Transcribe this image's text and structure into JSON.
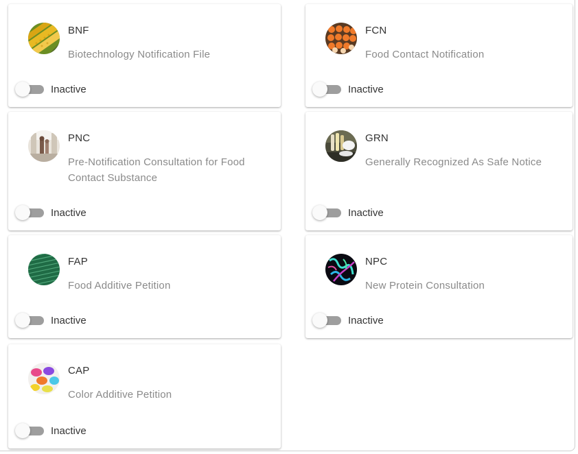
{
  "cards": [
    {
      "code": "BNF",
      "title": "Biotechnology Notification File",
      "status": "Inactive",
      "icon": "corn-image-icon"
    },
    {
      "code": "FCN",
      "title": "Food Contact Notification",
      "status": "Inactive",
      "icon": "eggs-image-icon"
    },
    {
      "code": "PNC",
      "title": "Pre-Notification Consultation for Food Contact Substance",
      "status": "Inactive",
      "icon": "kitchen-image-icon"
    },
    {
      "code": "GRN",
      "title": "Generally Recognized As Safe Notice",
      "status": "Inactive",
      "icon": "lab-tubes-image-icon"
    },
    {
      "code": "FAP",
      "title": "Food Additive Petition",
      "status": "Inactive",
      "icon": "green-pattern-image-icon"
    },
    {
      "code": "NPC",
      "title": "New Protein Consultation",
      "status": "Inactive",
      "icon": "protein-structure-image-icon"
    },
    {
      "code": "CAP",
      "title": "Color Additive Petition",
      "status": "Inactive",
      "icon": "color-powders-image-icon"
    }
  ],
  "colors": {
    "track_off": "#9e9e9e",
    "thumb": "#fafafa",
    "code_text": "#333333",
    "desc_text": "#8a8a8a"
  }
}
